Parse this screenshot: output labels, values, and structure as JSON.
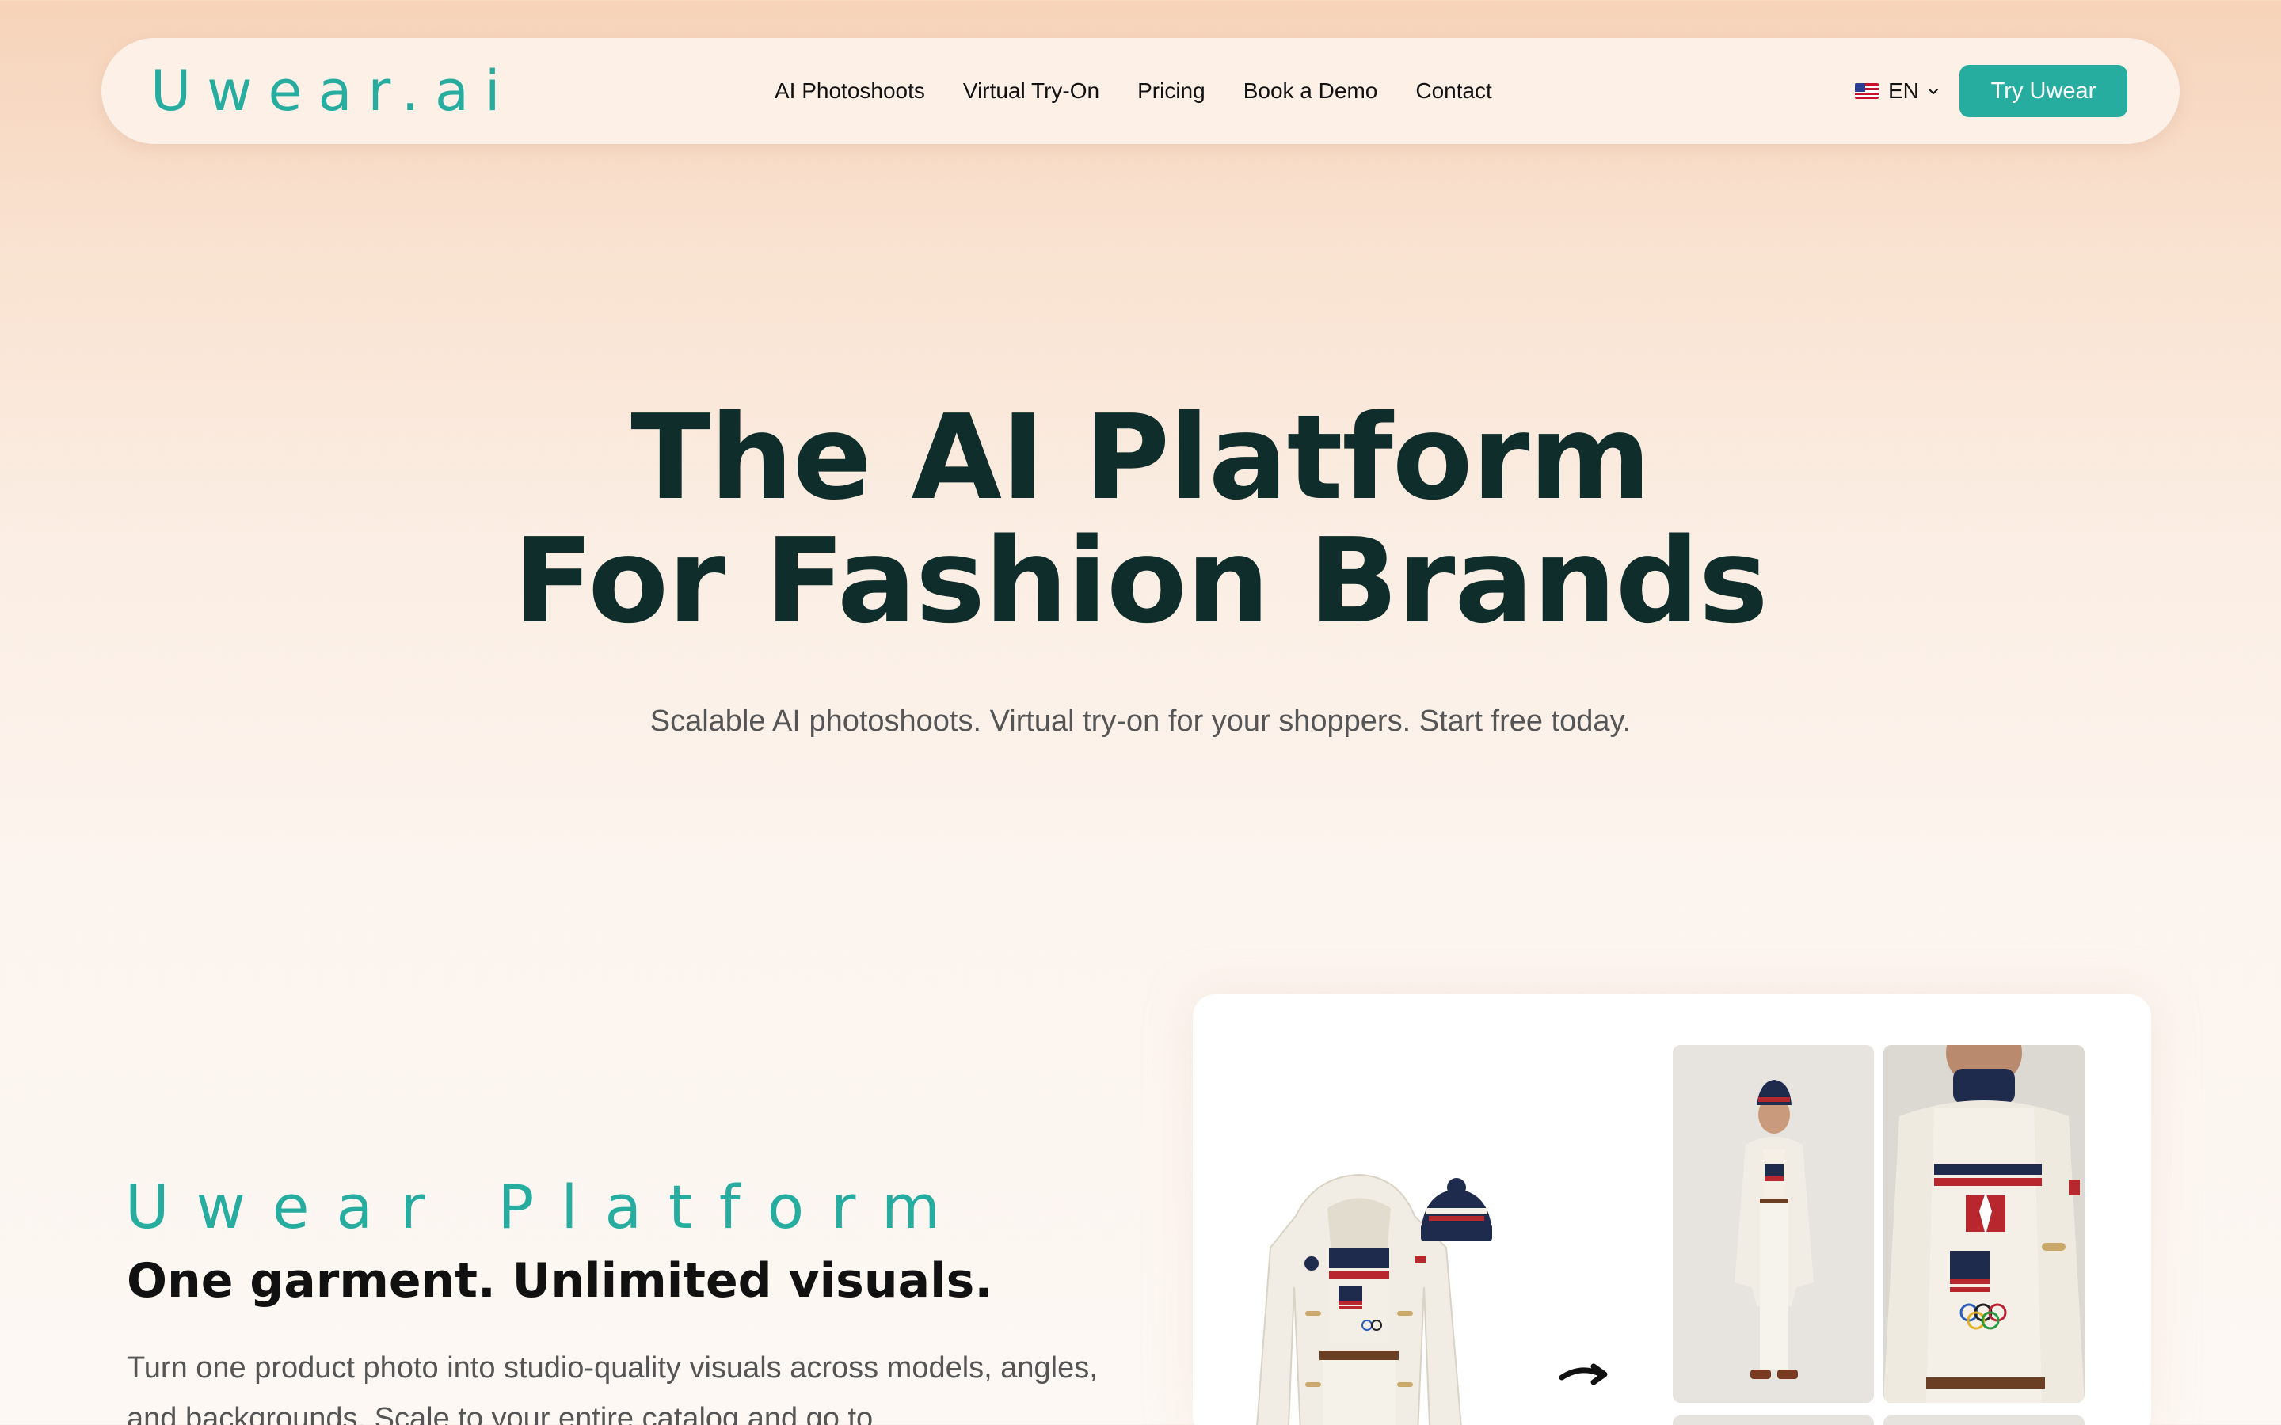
{
  "brand": {
    "logo_text": "Uwear.ai",
    "accent_color": "#27ada0",
    "text_color": "#0f2d2b"
  },
  "nav": {
    "links": [
      "AI Photoshoots",
      "Virtual Try-On",
      "Pricing",
      "Book a Demo",
      "Contact"
    ],
    "language": {
      "flag_icon": "us-flag-icon",
      "label": "EN",
      "chevron_icon": "chevron-down-icon"
    },
    "cta_label": "Try Uwear"
  },
  "hero": {
    "title_line1": "The AI Platform",
    "title_line2": "For Fashion Brands",
    "subtitle": "Scalable AI photoshoots. Virtual try-on for your shoppers. Start free today."
  },
  "platform": {
    "eyebrow": "Uwear Platform",
    "heading": "One garment. Unlimited visuals.",
    "body": "Turn one product photo into studio-quality visuals across models, angles, and backgrounds. Scale to your entire catalog and go to",
    "arrow_icon": "curved-arrow-right-icon"
  }
}
